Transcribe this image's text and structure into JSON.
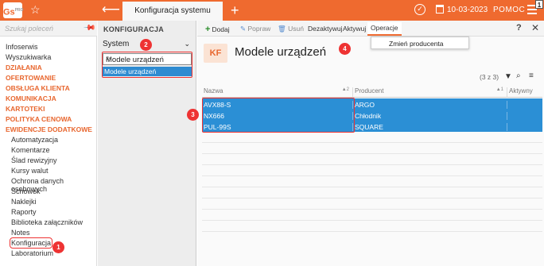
{
  "app": {
    "logo": "Gs",
    "logo_sup": "PRO",
    "tab_title": "Konfiguracja systemu",
    "date": "10-03-2023",
    "help": "POMOC",
    "badge": "1"
  },
  "sidebar": {
    "search_placeholder": "Szukaj poleceń",
    "items": [
      {
        "label": "Infoserwis",
        "type": "item"
      },
      {
        "label": "Wyszukiwarka",
        "type": "item"
      },
      {
        "label": "DZIAŁANIA",
        "type": "cat"
      },
      {
        "label": "OFERTOWANIE",
        "type": "cat"
      },
      {
        "label": "OBSŁUGA KLIENTA",
        "type": "cat"
      },
      {
        "label": "KOMUNIKACJA",
        "type": "cat"
      },
      {
        "label": "KARTOTEKI",
        "type": "cat"
      },
      {
        "label": "POLITYKA CENOWA",
        "type": "cat"
      },
      {
        "label": "EWIDENCJE DODATKOWE",
        "type": "cat"
      },
      {
        "label": "Automatyzacja",
        "type": "sub"
      },
      {
        "label": "Komentarze",
        "type": "sub"
      },
      {
        "label": "Ślad rewizyjny",
        "type": "sub"
      },
      {
        "label": "Kursy walut",
        "type": "sub"
      },
      {
        "label": "Ochrona danych osobowych",
        "type": "sub"
      },
      {
        "label": "Schowek",
        "type": "sub"
      },
      {
        "label": "Naklejki",
        "type": "sub"
      },
      {
        "label": "Raporty",
        "type": "sub"
      },
      {
        "label": "Biblioteka załączników",
        "type": "sub"
      },
      {
        "label": "Notes",
        "type": "sub"
      },
      {
        "label": "Konfiguracja",
        "type": "sub"
      },
      {
        "label": "Laboratorium",
        "type": "sub"
      }
    ]
  },
  "config": {
    "title": "KONFIGURACJA",
    "select_value": "System",
    "search_value": "Modele urządzeń",
    "result": "Modele urządzeń"
  },
  "toolbar": {
    "add": "Dodaj",
    "edit": "Popraw",
    "delete": "Usuń",
    "deactivate": "Dezaktywuj",
    "activate": "Aktywuj",
    "operations": "Operacje",
    "help": "?",
    "close": "✕"
  },
  "dropdown": {
    "item": "Zmień producenta"
  },
  "main": {
    "badge": "KF",
    "title": "Modele urządzeń",
    "count": "(3 z 3)",
    "columns": [
      "Nazwa",
      "Producent",
      "Aktywny"
    ],
    "sort_markers": [
      "2",
      "1",
      ""
    ],
    "rows": [
      {
        "name": "AVX88-S",
        "producer": "ARGO"
      },
      {
        "name": "NX666",
        "producer": "Chłodnik"
      },
      {
        "name": "PUL-99S",
        "producer": "SQUARE"
      }
    ]
  },
  "markers": [
    "1",
    "2",
    "3",
    "4"
  ]
}
